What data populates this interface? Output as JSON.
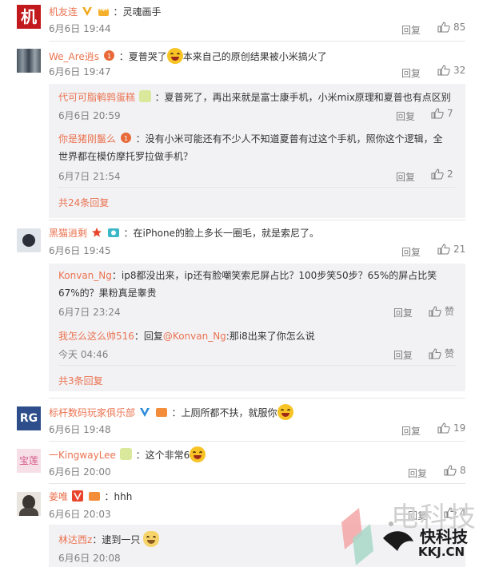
{
  "comments": [
    {
      "user": "机友连",
      "text": "：灵魂画手",
      "date": "6月6日 19:44",
      "reply": "回复",
      "likes": "85"
    },
    {
      "user": "We_Are逍s",
      "text_a": "：夏普哭了",
      "text_b": "本来自己的原创结果被小米搞火了",
      "date": "6月6日 19:47",
      "reply": "回复",
      "likes": "32",
      "subs": [
        {
          "user": "代可可脂鹌鹑蛋糕",
          "text": "：夏普死了，再出来就是富士康手机，小米mix原理和夏普也有点区别",
          "date": "6月6日 20:59",
          "reply": "回复",
          "likes": "7"
        },
        {
          "user": "你是猪刚鬣么",
          "text": "：没有小米可能还有不少人不知道夏普有过这个手机，照你这个逻辑，全世界都在模仿摩托罗拉做手机？",
          "date": "6月7日 21:54",
          "reply": "回复",
          "likes": "2"
        }
      ],
      "more": "共24条回复"
    },
    {
      "user": "黑猫逍剩",
      "text": "：在iPhone的脸上多长一圈毛，就是索尼了。",
      "date": "6月6日 19:45",
      "reply": "回复",
      "likes": "21",
      "subs": [
        {
          "user": "Konvan_Ng",
          "text": "：ip8都没出来，ip还有脸嘲笑索尼屏占比？100步笑50步？65%的屏占比笑67%的？果粉真是睾贵",
          "date": "6月7日 23:24",
          "reply": "回复",
          "likes": "赞"
        },
        {
          "user": "我怎么这么帅516",
          "text_a": "：回复",
          "mention": "@Konvan_Ng",
          "text_b": ":那i8出来了你怎么说",
          "date": "今天 04:46",
          "reply": "回复",
          "likes": "赞"
        }
      ],
      "more": "共3条回复"
    },
    {
      "user": "标杆数码玩家俱乐部",
      "text": "：上厕所都不扶，就服你",
      "date": "6月6日 19:48",
      "reply": "回复",
      "likes": "19"
    },
    {
      "user": "一KingwayLee",
      "text": "：这个非常6",
      "date": "6月6日 20:00",
      "reply": "回复",
      "likes": "8"
    },
    {
      "user": "姜唯",
      "text": "：hhh",
      "date": "6月6日 20:03",
      "reply": "回复",
      "likes": "4",
      "subs": [
        {
          "user": "林达西z",
          "text": "：逮到一只",
          "date": "6月6日 20:08"
        }
      ]
    }
  ],
  "avatars": {
    "a1": "机"
  },
  "watermark": {
    "brand": "快科技",
    "domain": "KKJ.CN",
    "big": "电科技"
  },
  "colors": {
    "username": "#eb7350",
    "meta": "#808080",
    "subbg": "#f2f2f5"
  }
}
